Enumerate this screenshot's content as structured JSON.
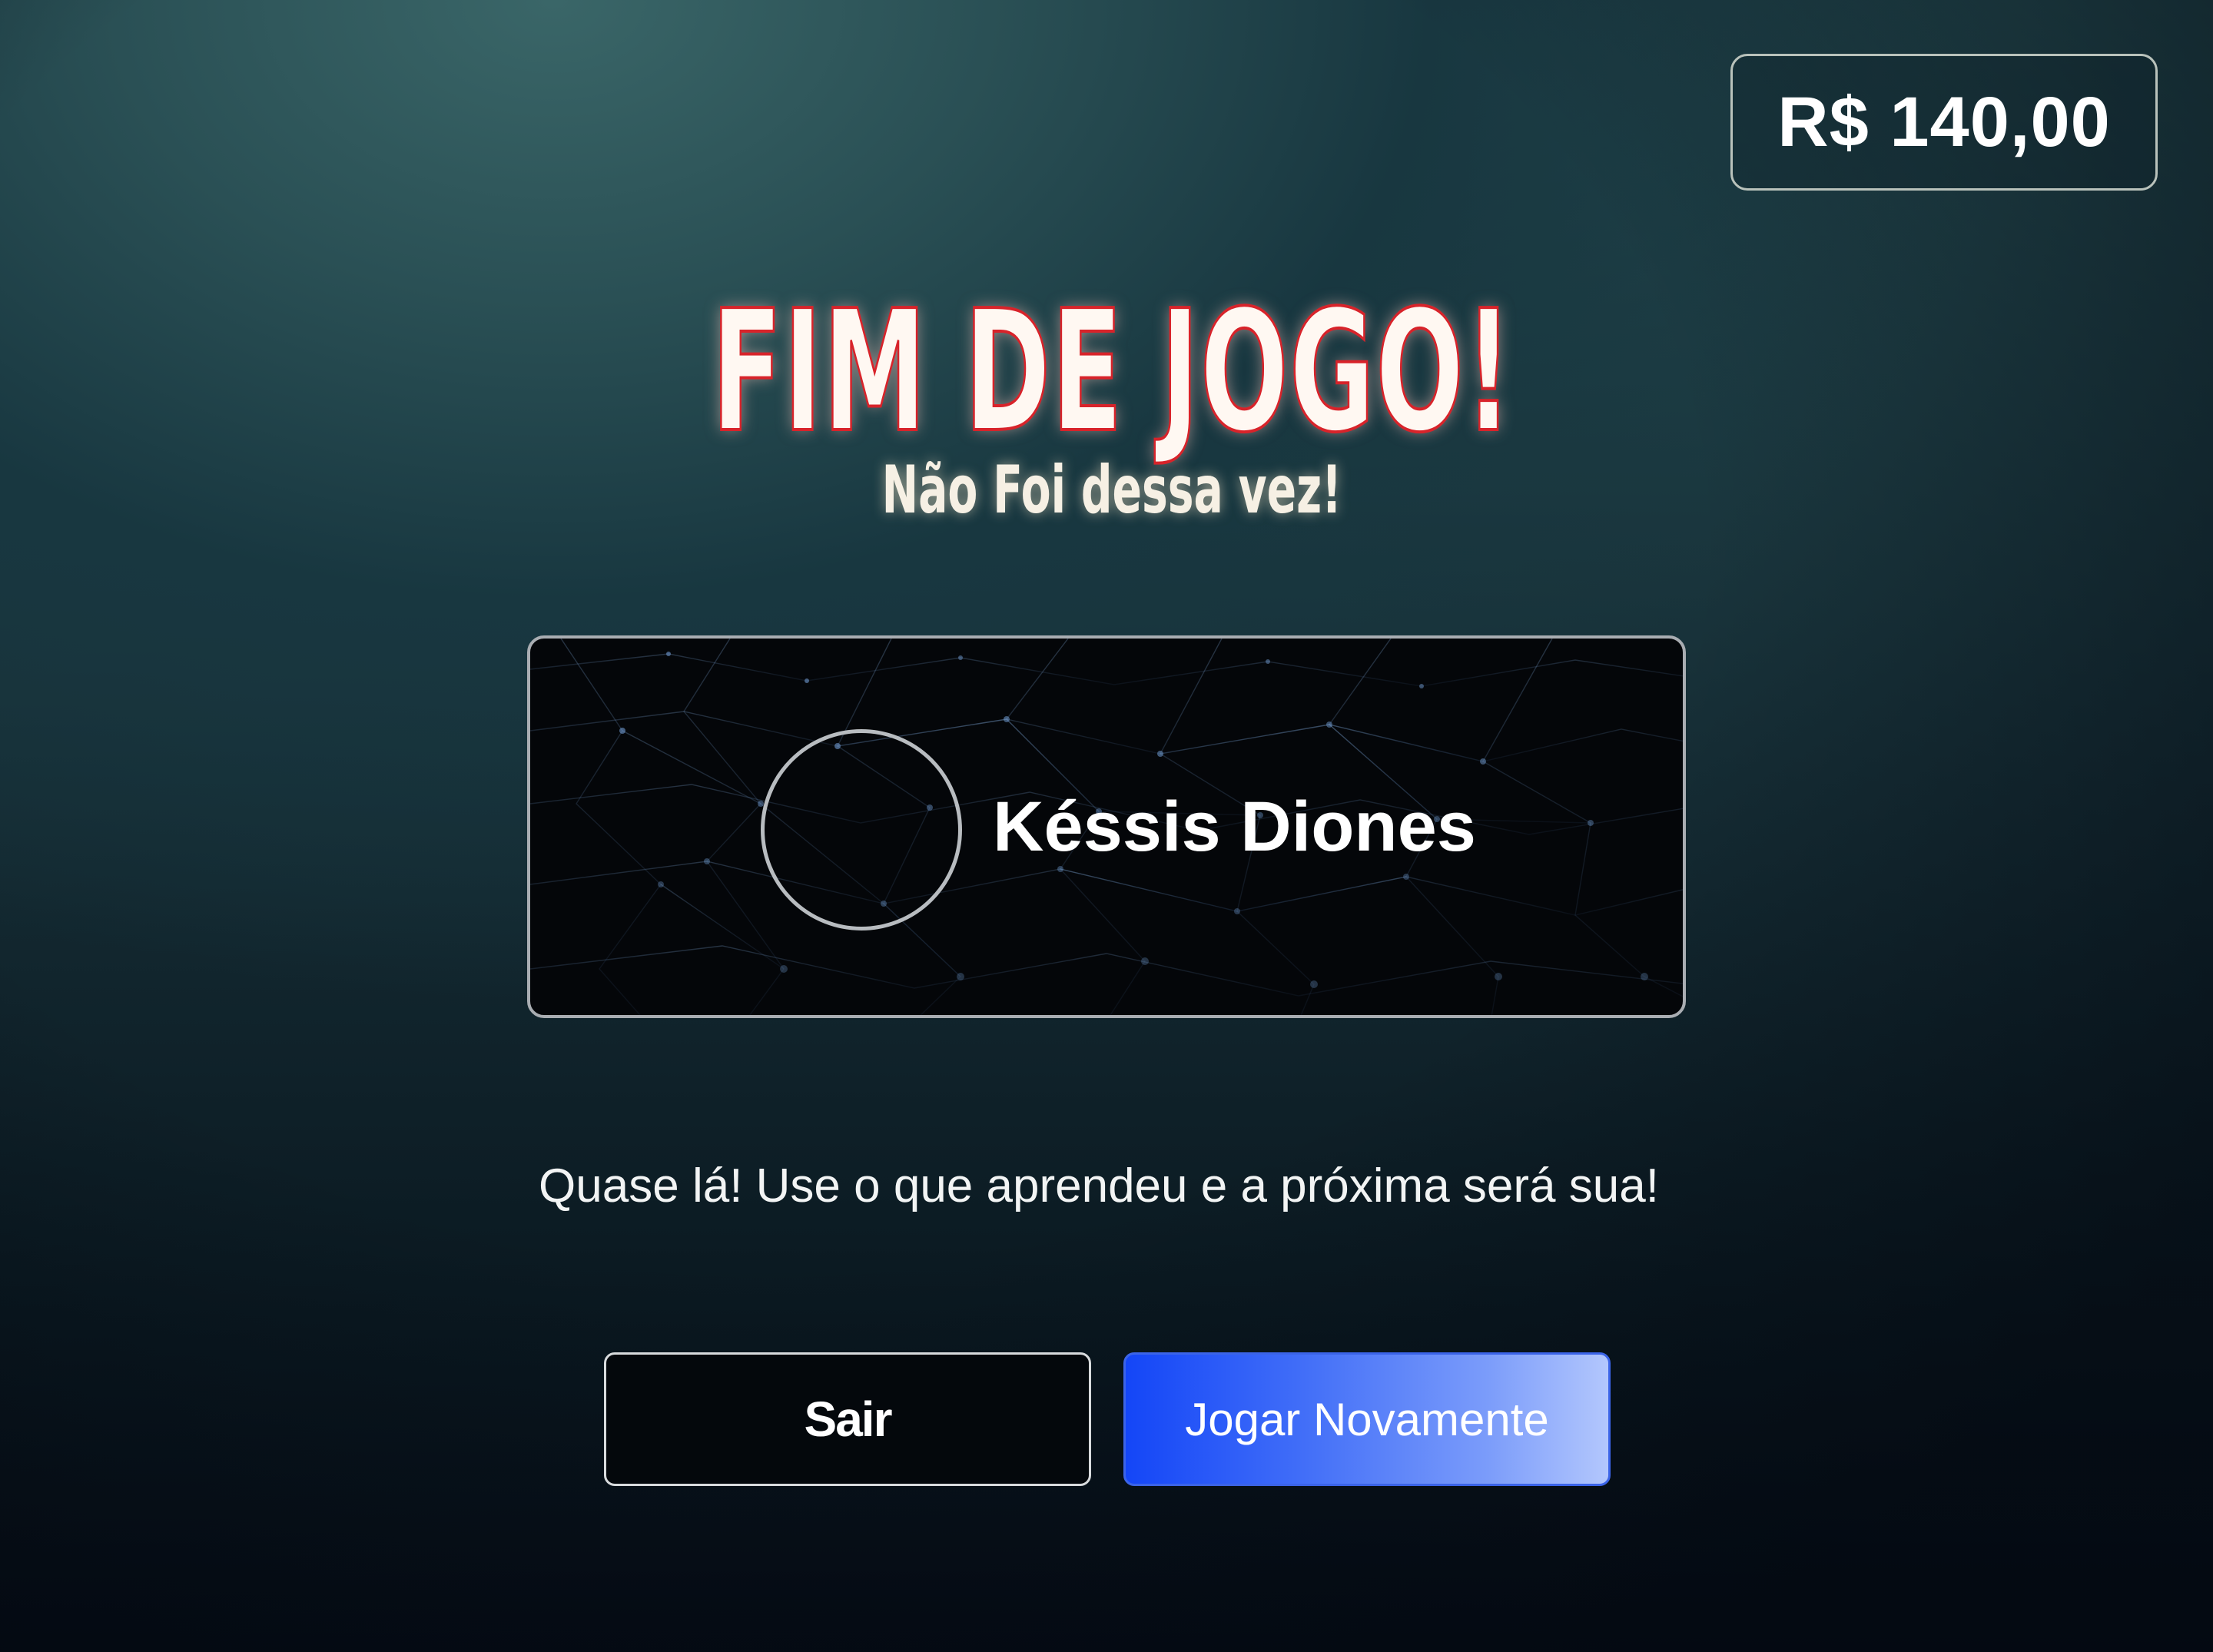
{
  "header": {
    "balance": "R$ 140,00"
  },
  "result": {
    "title": "FIM DE JOGO!",
    "subtitle": "Não Foi dessa vez!"
  },
  "player": {
    "name": "Késsis Diones"
  },
  "message": "Quase lá! Use o que aprendeu e a próxima será sua!",
  "actions": {
    "exit_label": "Sair",
    "replay_label": "Jogar Novamente"
  },
  "colors": {
    "title_outline": "#d8232a",
    "replay_button": "#1446f7",
    "card_background": "#040609"
  }
}
